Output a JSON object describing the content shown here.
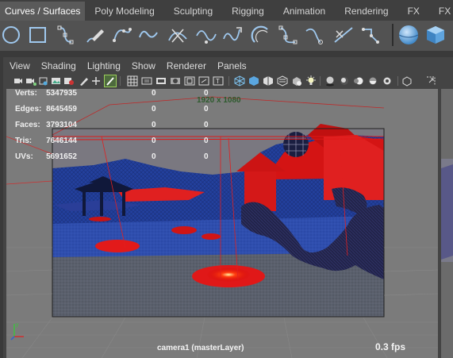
{
  "shelf": {
    "tabs": [
      {
        "label": "Curves / Surfaces",
        "active": true
      },
      {
        "label": "Poly Modeling"
      },
      {
        "label": "Sculpting"
      },
      {
        "label": "Rigging"
      },
      {
        "label": "Animation"
      },
      {
        "label": "Rendering"
      },
      {
        "label": "FX"
      },
      {
        "label": "FX Ca"
      }
    ],
    "icons": [
      "nurbs-circle-icon",
      "nurbs-square-icon",
      "cv-curve-icon",
      "pencil-curve-icon",
      "ep-curve-icon",
      "bezier-curve-icon",
      "cut-curve-icon",
      "bezier-tool-icon",
      "curve-arrow-icon",
      "arc-tool-icon",
      "curve-cv-icon",
      "extend-curve-icon",
      "insert-knot-icon",
      "rebuild-curve-icon",
      "nurbs-sphere-icon",
      "nurbs-cube-icon"
    ]
  },
  "panel": {
    "menus": [
      "View",
      "Shading",
      "Lighting",
      "Show",
      "Renderer",
      "Panels"
    ]
  },
  "viewport": {
    "resolution": "1920 x 1080",
    "camera": "camera1 (masterLayer)",
    "fps": "0.3 fps",
    "hud": [
      {
        "label": "Verts:",
        "v1": "5347935",
        "v2": "0",
        "v3": "0"
      },
      {
        "label": "Edges:",
        "v1": "8645459",
        "v2": "0",
        "v3": "0"
      },
      {
        "label": "Faces:",
        "v1": "3793104",
        "v2": "0",
        "v3": "0"
      },
      {
        "label": "Tris:",
        "v1": "7646144",
        "v2": "0",
        "v3": "0"
      },
      {
        "label": "UVs:",
        "v1": "5691652",
        "v2": "0",
        "v3": "0"
      }
    ]
  },
  "colors": {
    "mesh_blue": "#1e3c9a",
    "selection_red": "#e01010",
    "viewport_bg": "#7b7b7b",
    "hud_text": "#f0f0f0"
  }
}
